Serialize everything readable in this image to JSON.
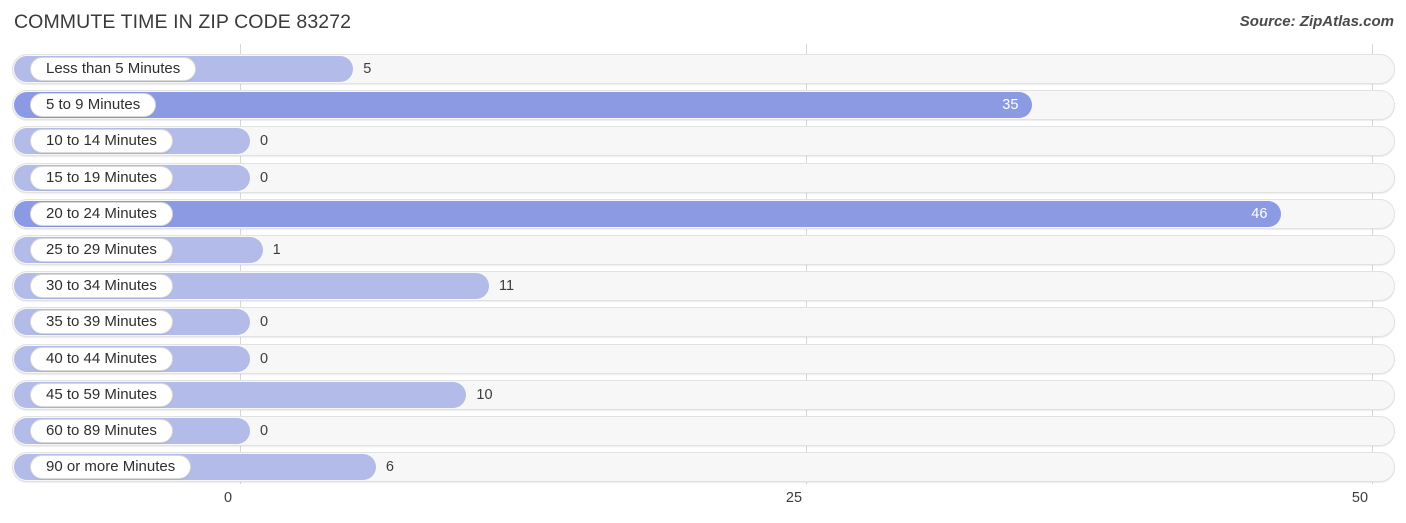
{
  "header": {
    "title": "COMMUTE TIME IN ZIP CODE 83272",
    "source": "Source: ZipAtlas.com"
  },
  "colors": {
    "bar_light": "#b3bbe9",
    "bar_strong": "#8b9ae2",
    "track_fill": "#f7f7f7",
    "track_border": "#e2e2e2",
    "gridline": "#d8d8d8",
    "text": "#3c3c3c"
  },
  "chart_data": {
    "type": "bar",
    "orientation": "horizontal",
    "title": "COMMUTE TIME IN ZIP CODE 83272",
    "xlabel": "",
    "ylabel": "",
    "xlim": [
      0,
      50
    ],
    "grid": true,
    "legend": null,
    "xticks": [
      "0",
      "25",
      "50"
    ],
    "xtick_values": [
      0,
      25,
      50
    ],
    "categories": [
      "Less than 5 Minutes",
      "5 to 9 Minutes",
      "10 to 14 Minutes",
      "15 to 19 Minutes",
      "20 to 24 Minutes",
      "25 to 29 Minutes",
      "30 to 34 Minutes",
      "35 to 39 Minutes",
      "40 to 44 Minutes",
      "45 to 59 Minutes",
      "60 to 89 Minutes",
      "90 or more Minutes"
    ],
    "values": [
      5,
      35,
      0,
      0,
      46,
      1,
      11,
      0,
      0,
      10,
      0,
      6
    ],
    "value_labels": [
      "5",
      "35",
      "0",
      "0",
      "46",
      "1",
      "11",
      "0",
      "0",
      "10",
      "0",
      "6"
    ]
  },
  "rows": [
    {
      "label": "Less than 5 Minutes",
      "value": 5,
      "value_label": "5",
      "inside": false,
      "strong": false
    },
    {
      "label": "5 to 9 Minutes",
      "value": 35,
      "value_label": "35",
      "inside": true,
      "strong": true
    },
    {
      "label": "10 to 14 Minutes",
      "value": 0,
      "value_label": "0",
      "inside": false,
      "strong": false
    },
    {
      "label": "15 to 19 Minutes",
      "value": 0,
      "value_label": "0",
      "inside": false,
      "strong": false
    },
    {
      "label": "20 to 24 Minutes",
      "value": 46,
      "value_label": "46",
      "inside": true,
      "strong": true
    },
    {
      "label": "25 to 29 Minutes",
      "value": 1,
      "value_label": "1",
      "inside": false,
      "strong": false
    },
    {
      "label": "30 to 34 Minutes",
      "value": 11,
      "value_label": "11",
      "inside": false,
      "strong": false
    },
    {
      "label": "35 to 39 Minutes",
      "value": 0,
      "value_label": "0",
      "inside": false,
      "strong": false
    },
    {
      "label": "40 to 44 Minutes",
      "value": 0,
      "value_label": "0",
      "inside": false,
      "strong": false
    },
    {
      "label": "45 to 59 Minutes",
      "value": 10,
      "value_label": "10",
      "inside": false,
      "strong": false
    },
    {
      "label": "60 to 89 Minutes",
      "value": 0,
      "value_label": "0",
      "inside": false,
      "strong": false
    },
    {
      "label": "90 or more Minutes",
      "value": 6,
      "value_label": "6",
      "inside": false,
      "strong": false
    }
  ]
}
